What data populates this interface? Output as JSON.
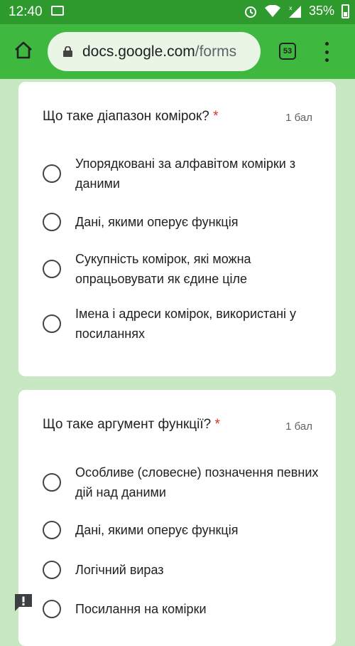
{
  "status_bar": {
    "time": "12:40",
    "battery": "35%"
  },
  "browser": {
    "url_domain": "docs.google.com",
    "url_path": "/forms",
    "tab_count": "53"
  },
  "questions": [
    {
      "title": "Що таке діапазон комірок?",
      "required_mark": "*",
      "points": "1 бал",
      "options": [
        "Упорядковані за алфавітом комірки з даними",
        "Дані, якими оперує функція",
        "Сукупність комірок, які можна опрацьовувати як єдине ціле",
        "Імена і адреси комірок, використані у посиланнях"
      ]
    },
    {
      "title": "Що таке аргумент функції?",
      "required_mark": "*",
      "points": "1 бал",
      "options": [
        "Особливе (словесне) позначення певних дій над даними",
        "Дані, якими оперує функція",
        "Логічний вираз",
        "Посилання на комірки"
      ]
    }
  ],
  "colors": {
    "status_bar": "#2e9a2e",
    "toolbar": "#3fb83f",
    "background": "#c8e8c4",
    "required": "#d93025"
  }
}
